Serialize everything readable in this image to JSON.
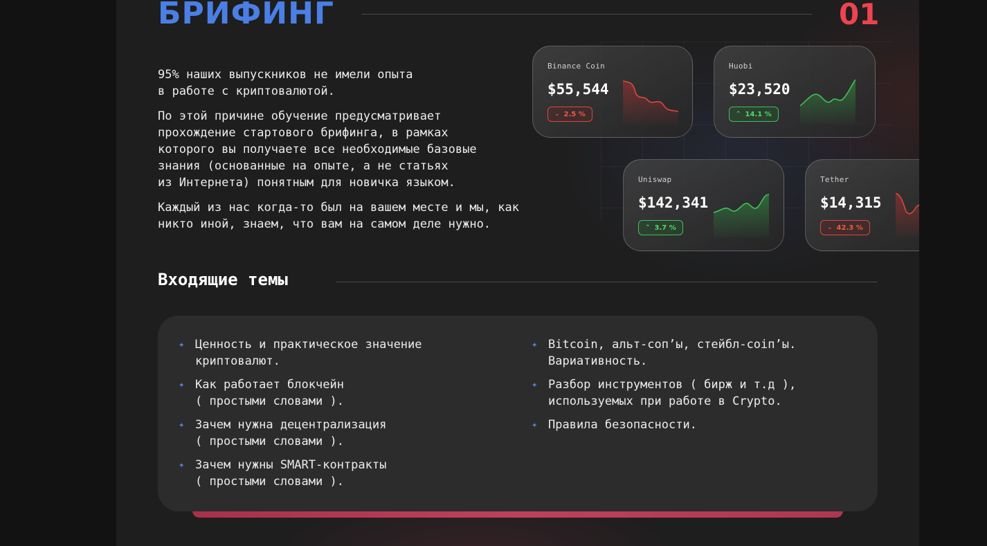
{
  "header": {
    "title": "БРИФИНГ",
    "number": "01"
  },
  "intro": {
    "paragraphs": [
      "95% наших выпускников не имели опыта\nв работе с криптовалютой.",
      "По этой причине обучение предусматривает\nпрохождение стартового брифинга, в рамках\nкоторого вы получаете все необходимые базовые\nзнания (основанные на опыте, а не статьях\nиз Интернета) понятным для новичка языком.",
      "Каждый из нас когда-то был на вашем месте и мы, как\nникто иной, знаем, что вам на самом деле нужно."
    ]
  },
  "cards": [
    {
      "name": "Binance Coin",
      "price": "$55,544",
      "change": "2.5 %",
      "trend": "down",
      "icon": "arrow-down-icon"
    },
    {
      "name": "Huobi",
      "price": "$23,520",
      "change": "14.1 %",
      "trend": "up",
      "icon": "arrow-up-icon"
    },
    {
      "name": "Uniswap",
      "price": "$142,341",
      "change": "3.7 %",
      "trend": "up",
      "icon": "arrow-up-icon"
    },
    {
      "name": "Tether",
      "price": "$14,315",
      "change": "42.3 %",
      "trend": "down",
      "icon": "arrow-down-icon"
    }
  ],
  "topics": {
    "title": "Входящие темы",
    "left": [
      "Ценность и практическое значение\nкриптовалют.",
      "Как работает блокчейн\n( простыми словами ).",
      "Зачем нужна децентрализация\n( простыми словами ).",
      "Зачем нужны SMART-контракты\n( простыми словами )."
    ],
    "right": [
      "Bitcoin, альт-coп’ы, стейбл-coiп’ы.\nВариативность.",
      "Разбор инструментов ( бирж и т.д ),\nиспользуемых при работе в Crypto.",
      "Правила безопасности."
    ],
    "bullet_icon": "sparkle-icon"
  },
  "colors": {
    "accent_blue": "#4a7fe6",
    "accent_red": "#ee4350",
    "up_green": "#3fc25a",
    "down_red": "#d84a3a"
  }
}
